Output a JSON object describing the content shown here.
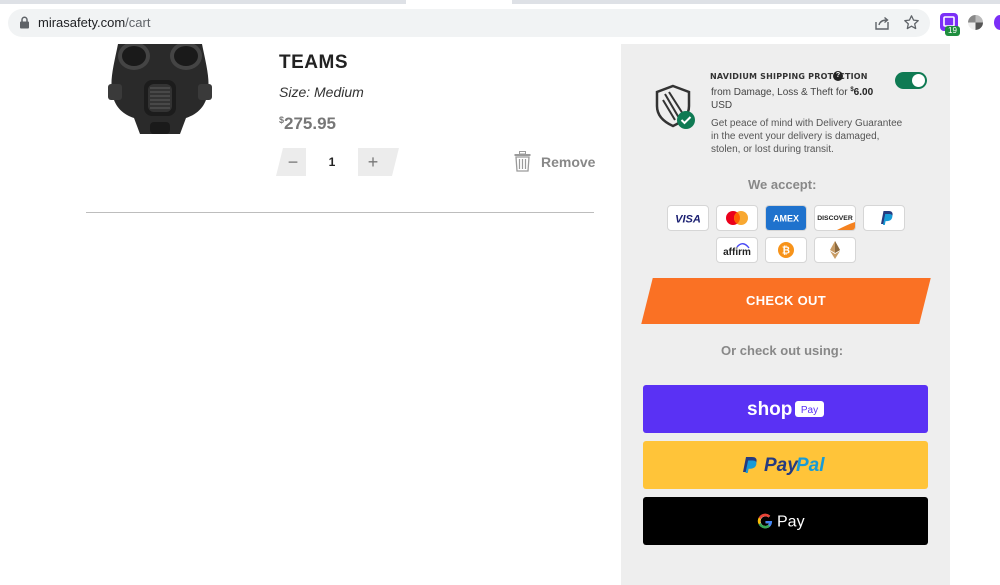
{
  "browser": {
    "url_host": "mirasafety.com",
    "url_path": "/cart",
    "extension_badge": "19"
  },
  "cart": {
    "item": {
      "name": "TEAMS",
      "size": "Size: Medium",
      "price_currency": "$",
      "price": "275.95",
      "quantity": "1",
      "qty_minus": "−",
      "qty_plus": "+",
      "remove_label": "Remove"
    }
  },
  "summary": {
    "protection": {
      "title": "Navidium Shipping Protection",
      "help": "?",
      "enabled": true,
      "line_prefix": "from Damage, Loss & Theft for ",
      "price_currency": "$",
      "price": "6.00",
      "currency_code": "USD",
      "description": "Get peace of mind with Delivery Guarantee in the event your delivery is damaged, stolen, or lost during transit."
    },
    "we_accept": "We accept:",
    "payment_methods": [
      "VISA",
      "Mastercard",
      "AMEX",
      "DISCOVER",
      "PayPal",
      "affirm",
      "Bitcoin",
      "Ethereum"
    ],
    "checkout_label": "CHECK OUT",
    "or_checkout": "Or check out using:",
    "express": {
      "shop_pay": "shop Pay",
      "paypal": "PayPal",
      "gpay": "G Pay"
    },
    "colors": {
      "checkout": "#fa7124",
      "shop_pay": "#5a31f4",
      "paypal": "#ffc439",
      "gpay": "#000000",
      "toggle": "#0f7a53"
    }
  }
}
